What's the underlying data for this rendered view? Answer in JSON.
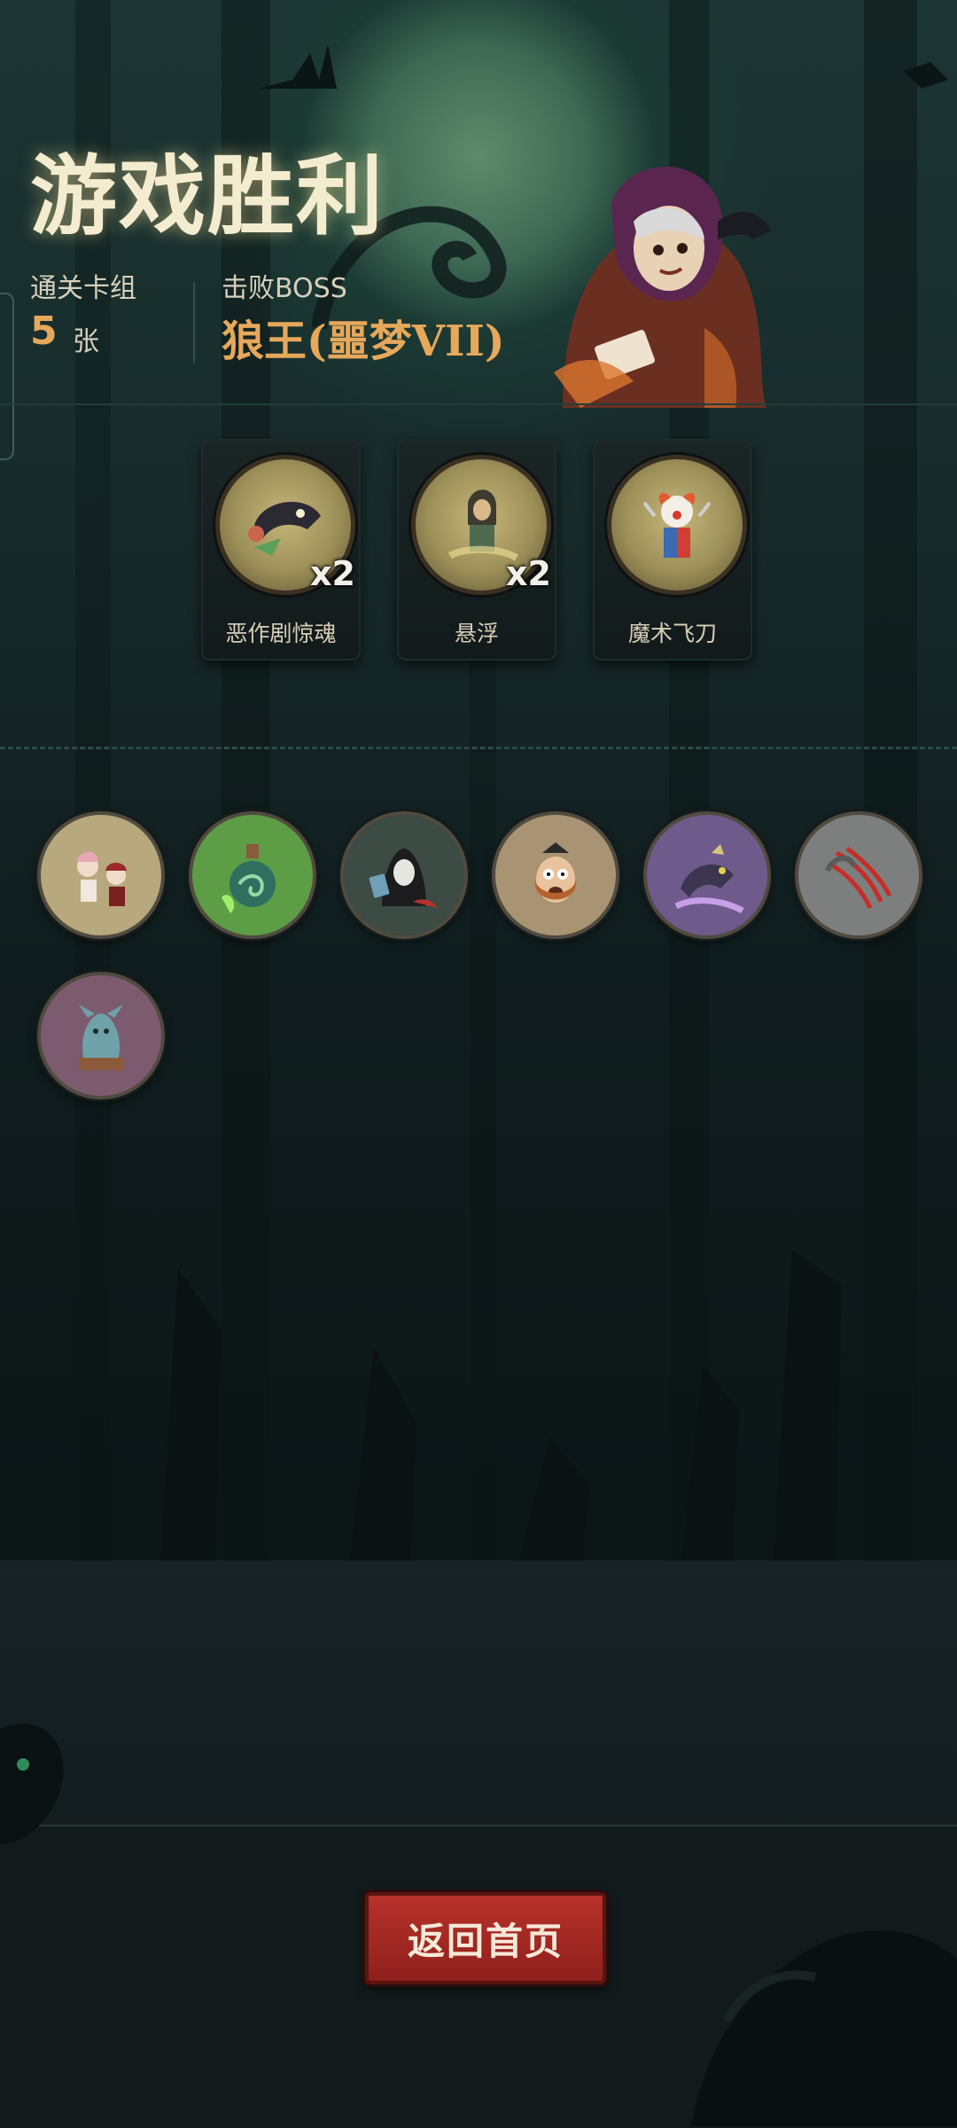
{
  "result": {
    "title": "游戏胜利",
    "deck_label": "通关卡组",
    "deck_count": "5",
    "deck_unit": "张",
    "boss_label": "击败BOSS",
    "boss_name": "狼王(噩梦VII)"
  },
  "cards": [
    {
      "label": "恶作剧惊魂",
      "multiplier": "x2",
      "icon": "cat-prank-icon"
    },
    {
      "label": "悬浮",
      "multiplier": "x2",
      "icon": "levitate-icon"
    },
    {
      "label": "魔术飞刀",
      "multiplier": "",
      "icon": "clown-knife-icon"
    }
  ],
  "relics": [
    {
      "icon": "music-girls-icon",
      "bg": "#b7a87d"
    },
    {
      "icon": "green-potion-icon",
      "bg": "#5c9d46"
    },
    {
      "icon": "hooded-dealer-icon",
      "bg": "#3c4b44"
    },
    {
      "icon": "screaming-man-icon",
      "bg": "#a89373"
    },
    {
      "icon": "purple-beast-icon",
      "bg": "#6f5a8c"
    },
    {
      "icon": "claw-slash-icon",
      "bg": "#7d7f7e"
    },
    {
      "icon": "gargoyle-statue-icon",
      "bg": "#7d5b6e"
    }
  ],
  "footer": {
    "home_label": "返回首页"
  },
  "colors": {
    "accent_gold": "#e6a85a",
    "button_red": "#b8312a"
  }
}
